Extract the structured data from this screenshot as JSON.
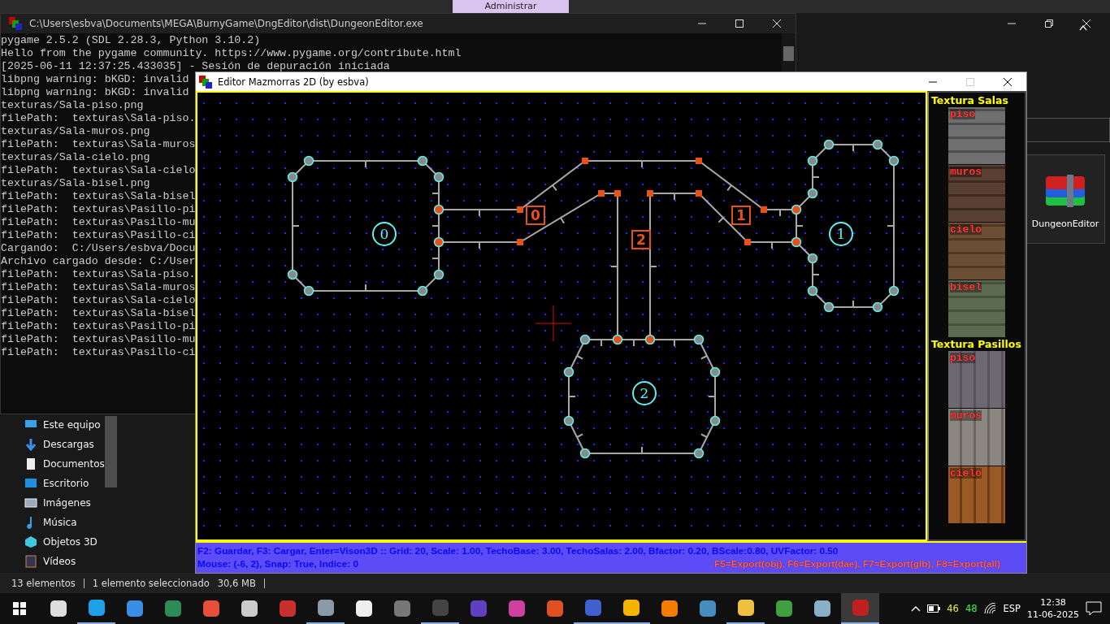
{
  "explorer": {
    "ribbon_tab": "Administrar",
    "nav_items": [
      {
        "label": "Este equipo"
      },
      {
        "label": "Descargas"
      },
      {
        "label": "Documentos"
      },
      {
        "label": "Escritorio"
      },
      {
        "label": "Imágenes"
      },
      {
        "label": "Música"
      },
      {
        "label": "Objetos 3D"
      },
      {
        "label": "Vídeos"
      }
    ],
    "file": {
      "name": "DungeonEditor",
      "selected": true
    },
    "status": [
      "13 elementos",
      "1 elemento seleccionado",
      "30,6 MB"
    ]
  },
  "console": {
    "title": "C:\\Users\\esbva\\Documents\\MEGA\\BurnyGame\\DngEditor\\dist\\DungeonEditor.exe",
    "lines": [
      "pygame 2.5.2 (SDL 2.28.3, Python 3.10.2)",
      "Hello from the pygame community. https://www.pygame.org/contribute.html",
      "[2025-06-11 12:37:25.433035] - Sesión de depuración iniciada",
      "libpng warning: bKGD: invalid",
      "libpng warning: bKGD: invalid",
      "texturas/Sala-piso.png",
      "filePath:  texturas\\Sala-piso.",
      "texturas/Sala-muros.png",
      "filePath:  texturas\\Sala-muros",
      "texturas/Sala-cielo.png",
      "filePath:  texturas\\Sala-cielo",
      "texturas/Sala-bisel.png",
      "filePath:  texturas\\Sala-bisel",
      "filePath:  texturas\\Pasillo-pi",
      "filePath:  texturas\\Pasillo-mu",
      "filePath:  texturas\\Pasillo-ci",
      "Cargando:  C:/Users/esbva/Docu",
      "Archivo cargado desde: C:/User",
      "filePath:  texturas\\Sala-piso.",
      "filePath:  texturas\\Sala-muros",
      "filePath:  texturas\\Sala-cielo",
      "filePath:  texturas\\Sala-bisel",
      "filePath:  texturas\\Pasillo-pi",
      "filePath:  texturas\\Pasillo-mu",
      "filePath:  texturas\\Pasillo-ci"
    ]
  },
  "editor": {
    "title": "Editor Mazmorras 2D (by esbva)",
    "rooms": [
      {
        "label": "0"
      },
      {
        "label": "1"
      },
      {
        "label": "2"
      }
    ],
    "corridors": [
      {
        "label": "0"
      },
      {
        "label": "1"
      },
      {
        "label": "2"
      }
    ],
    "panel": [
      {
        "title": "Textura Salas",
        "textures": [
          {
            "label": "piso"
          },
          {
            "label": "muros"
          },
          {
            "label": "cielo"
          },
          {
            "label": "bisel"
          }
        ]
      },
      {
        "title": "Textura Pasillos",
        "textures": [
          {
            "label": "piso"
          },
          {
            "label": "muros"
          },
          {
            "label": "cielo"
          }
        ]
      }
    ],
    "status": {
      "line_1": "F2: Guardar, F3: Cargar, Enter=Vison3D :: Grid: 20, Scale: 1.00, TechoBase: 3.00, TechoSalas: 2.00, Bfactor: 0.20, BScale:0.80, UVFactor: 0.50",
      "line_2": "Mouse: (-6, 2), Snap: True, Indice: 0",
      "exports": "F5=Export(obj), F6=Export(dae), F7=Export(glb), F8=Export(all)"
    }
  },
  "taskbar": {
    "apps": [
      {
        "running": false,
        "selected": false
      },
      {
        "running": true,
        "selected": false
      },
      {
        "running": false,
        "selected": false
      },
      {
        "running": false,
        "selected": false
      },
      {
        "running": false,
        "selected": false
      },
      {
        "running": false,
        "selected": false
      },
      {
        "running": false,
        "selected": false
      },
      {
        "running": true,
        "selected": false
      },
      {
        "running": false,
        "selected": false
      },
      {
        "running": false,
        "selected": false
      },
      {
        "running": true,
        "selected": false
      },
      {
        "running": false,
        "selected": false
      },
      {
        "running": false,
        "selected": false
      },
      {
        "running": false,
        "selected": false
      },
      {
        "running": true,
        "selected": false
      },
      {
        "running": true,
        "selected": false
      },
      {
        "running": false,
        "selected": false
      },
      {
        "running": false,
        "selected": false
      },
      {
        "running": true,
        "selected": false
      },
      {
        "running": false,
        "selected": false
      },
      {
        "running": false,
        "selected": false
      },
      {
        "running": true,
        "selected": true
      }
    ],
    "tray": {
      "reading_1": "46",
      "reading_2": "48",
      "language": "ESP",
      "time": "12:38",
      "date": "11-06-2025"
    }
  }
}
